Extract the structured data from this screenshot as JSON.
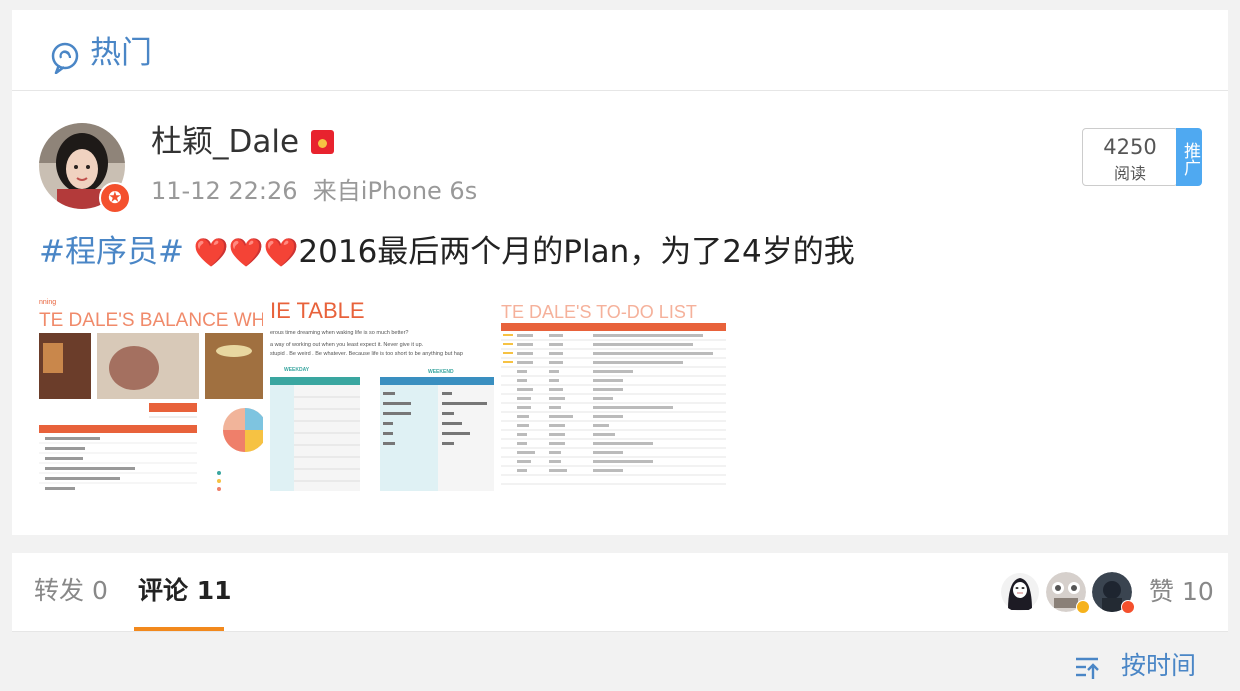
{
  "header": {
    "title": "热门",
    "icon": "hot-topic-icon",
    "accent": "#4a86c6"
  },
  "post": {
    "username": "杜颖_Dale",
    "timestamp": "11-12 22:26",
    "source": "来自iPhone 6s",
    "reads_count": "4250",
    "reads_label": "阅读",
    "promote_label": "推广",
    "text": {
      "tag": "#程序员#",
      "hearts": "❤️❤️❤️",
      "body": "2016最后两个月的Plan，为了24岁的我"
    },
    "images": [
      {
        "title": "TE DALE'S BALANCE WHE",
        "subtitle": "nning"
      },
      {
        "title": "IE TABLE",
        "lines": [
          "erous time dreaming when waking life is so much better?",
          "a way of working out when you least expect it. Never give it up.",
          "stupid . Be weird . Be whatever. Because life is too short to be anything but hap"
        ],
        "weekday": "WEEKDAY",
        "weekend": "WEEKEND"
      },
      {
        "title": "TE DALE'S TO-DO LIST"
      }
    ]
  },
  "tabs": {
    "forward_label": "转发",
    "forward_count": "0",
    "comment_label": "评论",
    "comment_count": "11",
    "like_label": "赞",
    "like_count": "10",
    "active_color": "#f2891d"
  },
  "sort": {
    "label": "按时间",
    "icon": "sort-icon"
  }
}
